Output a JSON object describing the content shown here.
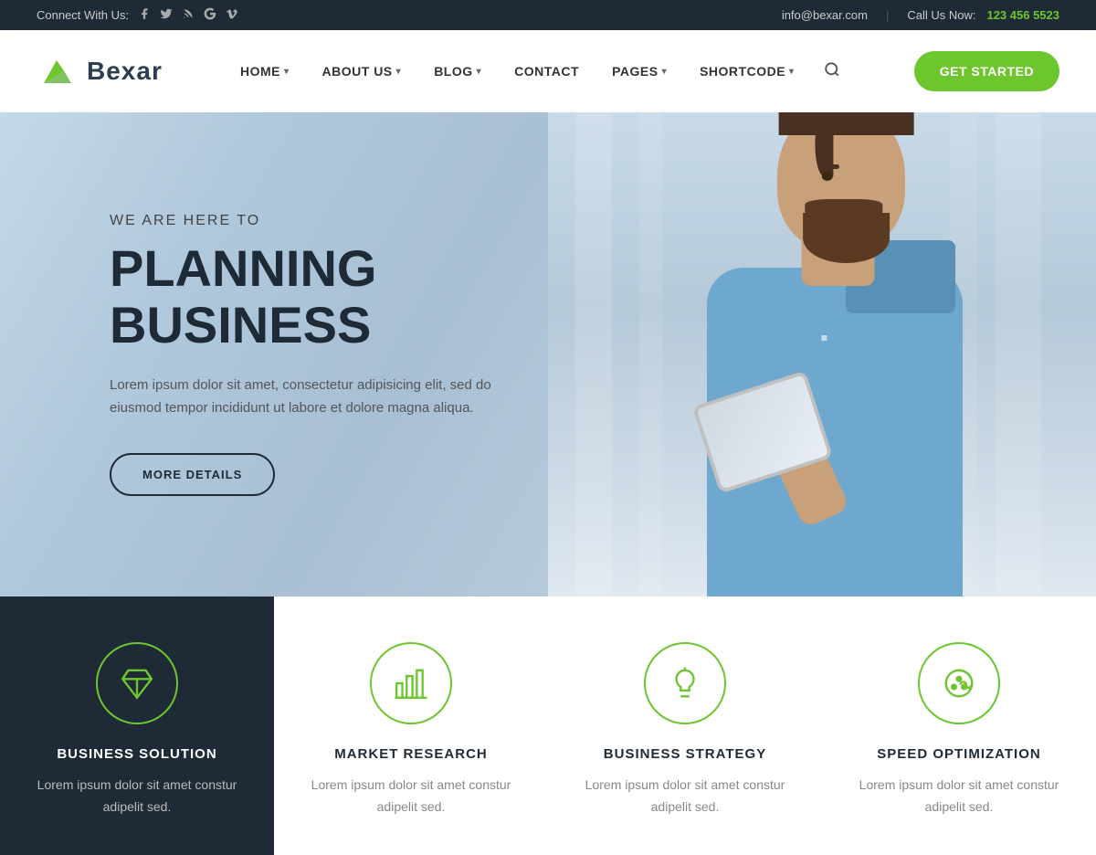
{
  "topbar": {
    "connect_label": "Connect With Us:",
    "email": "info@bexar.com",
    "call_label": "Call Us Now:",
    "phone": "123 456 5523",
    "social_icons": [
      "f",
      "t",
      "rss",
      "g+",
      "v"
    ]
  },
  "header": {
    "logo_text": "Bexar",
    "nav": [
      {
        "label": "HOME",
        "has_arrow": true
      },
      {
        "label": "ABOUT US",
        "has_arrow": true
      },
      {
        "label": "BLOG",
        "has_arrow": true
      },
      {
        "label": "CONTACT",
        "has_arrow": false
      },
      {
        "label": "PAGES",
        "has_arrow": true
      },
      {
        "label": "SHORTCODE",
        "has_arrow": true
      }
    ],
    "cta_button": "GET STARTED"
  },
  "hero": {
    "subtitle": "WE ARE HERE TO",
    "title": "PLANNING BUSINESS",
    "description": "Lorem ipsum dolor sit amet, consectetur adipisicing elit, sed do eiusmod tempor incididunt ut labore et dolore magna aliqua.",
    "cta_button": "MORE DETAILS"
  },
  "cards": [
    {
      "title": "BUSINESS SOLUTION",
      "description": "Lorem ipsum dolor sit amet constur adipelit sed.",
      "icon": "diamond"
    },
    {
      "title": "MARKET RESEARCH",
      "description": "Lorem ipsum dolor sit amet constur adipelit sed.",
      "icon": "bar-chart"
    },
    {
      "title": "BUSINESS STRATEGY",
      "description": "Lorem ipsum dolor sit amet constur adipelit sed.",
      "icon": "lightbulb"
    },
    {
      "title": "SPEED OPTIMIZATION",
      "description": "Lorem ipsum dolor sit amet constur adipelit sed.",
      "icon": "palette"
    }
  ]
}
